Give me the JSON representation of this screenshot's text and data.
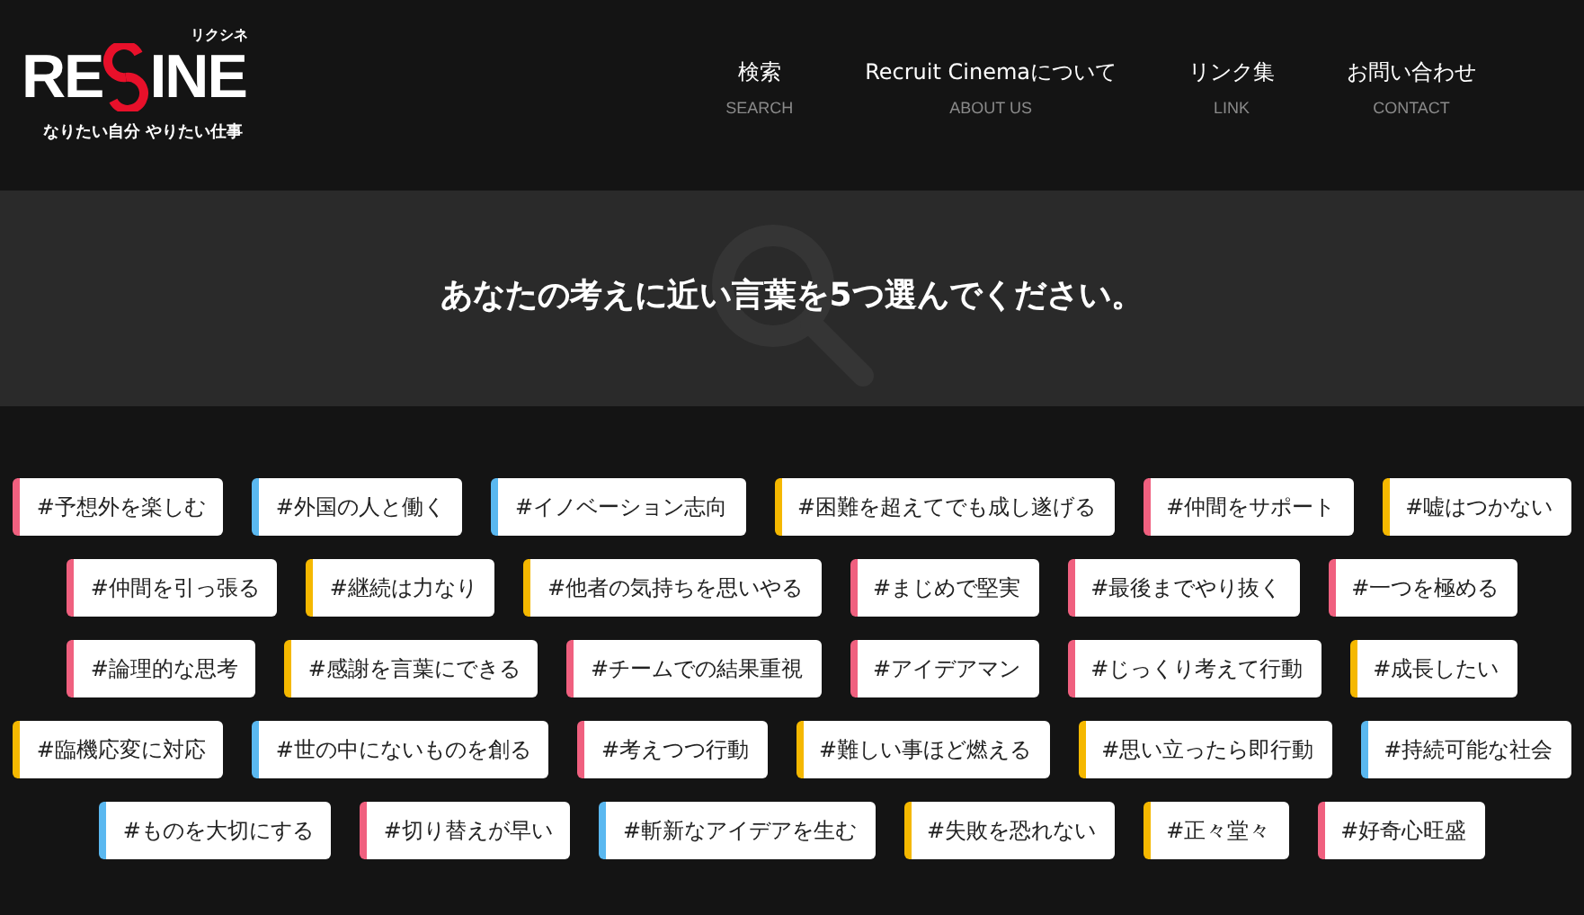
{
  "logo": {
    "left": "RE",
    "right": "INE",
    "ruby": "リクシネ",
    "tagline": "なりたい自分 やりたい仕事"
  },
  "nav": [
    {
      "label": "検索",
      "sub": "SEARCH"
    },
    {
      "label": "Recruit Cinemaについて",
      "sub": "ABOUT US"
    },
    {
      "label": "リンク集",
      "sub": "LINK"
    },
    {
      "label": "お問い合わせ",
      "sub": "CONTACT"
    }
  ],
  "heading": "あなたの考えに近い言葉を5つ選んでください。",
  "tag_rows": [
    [
      {
        "label": "#予想外を楽しむ",
        "color": "#f0607f"
      },
      {
        "label": "#外国の人と働く",
        "color": "#5ab8f0"
      },
      {
        "label": "#イノベーション志向",
        "color": "#5ab8f0"
      },
      {
        "label": "#困難を超えてでも成し遂げる",
        "color": "#f5b800"
      },
      {
        "label": "#仲間をサポート",
        "color": "#f0607f"
      },
      {
        "label": "#嘘はつかない",
        "color": "#f5b800"
      }
    ],
    [
      {
        "label": "#仲間を引っ張る",
        "color": "#f0607f"
      },
      {
        "label": "#継続は力なり",
        "color": "#f5b800"
      },
      {
        "label": "#他者の気持ちを思いやる",
        "color": "#f5b800"
      },
      {
        "label": "#まじめで堅実",
        "color": "#f0607f"
      },
      {
        "label": "#最後までやり抜く",
        "color": "#f0607f"
      },
      {
        "label": "#一つを極める",
        "color": "#f0607f"
      }
    ],
    [
      {
        "label": "#論理的な思考",
        "color": "#f0607f"
      },
      {
        "label": "#感謝を言葉にできる",
        "color": "#f5b800"
      },
      {
        "label": "#チームでの結果重視",
        "color": "#f0607f"
      },
      {
        "label": "#アイデアマン",
        "color": "#f0607f"
      },
      {
        "label": "#じっくり考えて行動",
        "color": "#f0607f"
      },
      {
        "label": "#成長したい",
        "color": "#f5b800"
      }
    ],
    [
      {
        "label": "#臨機応変に対応",
        "color": "#f5b800"
      },
      {
        "label": "#世の中にないものを創る",
        "color": "#5ab8f0"
      },
      {
        "label": "#考えつつ行動",
        "color": "#f0607f"
      },
      {
        "label": "#難しい事ほど燃える",
        "color": "#f5b800"
      },
      {
        "label": "#思い立ったら即行動",
        "color": "#f5b800"
      },
      {
        "label": "#持続可能な社会",
        "color": "#5ab8f0"
      }
    ],
    [
      {
        "label": "#ものを大切にする",
        "color": "#5ab8f0"
      },
      {
        "label": "#切り替えが早い",
        "color": "#f0607f"
      },
      {
        "label": "#斬新なアイデアを生む",
        "color": "#5ab8f0"
      },
      {
        "label": "#失敗を恐れない",
        "color": "#f5b800"
      },
      {
        "label": "#正々堂々",
        "color": "#f5b800"
      },
      {
        "label": "#好奇心旺盛",
        "color": "#f0607f"
      }
    ]
  ]
}
